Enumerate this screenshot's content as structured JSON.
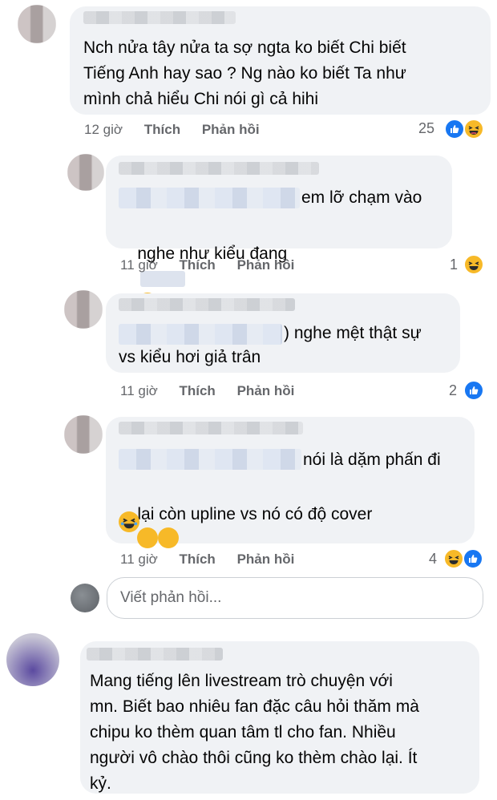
{
  "comments": [
    {
      "text": "Nch nửa tây nửa ta sợ ngta ko biết Chi biết\nTiếng Anh hay sao ? Ng nào ko biết Ta như\nmình chả hiểu Chi nói gì cả hihi",
      "time": "12 giờ",
      "like": "Thích",
      "reply": "Phản hồi",
      "reactions": "25",
      "reaction_icons": [
        "like-icon",
        "haha-icon"
      ]
    }
  ],
  "replies": [
    {
      "line1": "em lỡ chạm vào",
      "line2a": "nghe như kiểu đang",
      "time": "11 giờ",
      "like": "Thích",
      "reply": "Phản hồi",
      "reactions": "1",
      "reaction_icons": [
        "haha-icon"
      ]
    },
    {
      "line1": ") nghe mệt thật sự",
      "line2": "vs kiểu hơi giả trân",
      "time": "11 giờ",
      "like": "Thích",
      "reply": "Phản hồi",
      "reactions": "2",
      "reaction_icons": [
        "like-icon"
      ]
    },
    {
      "line1": "nói là dặm phấn đi",
      "line2": "lại còn upline vs nó có độ cover",
      "time": "11 giờ",
      "like": "Thích",
      "reply": "Phản hồi",
      "reactions": "4",
      "reaction_icons": [
        "haha-icon",
        "like-icon"
      ]
    }
  ],
  "reply_input": {
    "placeholder": "Viết phản hồi..."
  },
  "last_comment": {
    "text": "Mang tiếng lên livestream trò chuyện với\nmn. Biết bao nhiêu fan đặc câu hỏi thăm mà\nchipu ko thèm quan tâm tl cho fan. Nhiều\nngười vô chào thôi cũng ko thèm chào lại. Ít\nkỷ."
  },
  "colors": {
    "like_blue": "#1877f2",
    "haha_yellow": "#f7b928",
    "bubble": "#f0f2f5",
    "meta_gray": "#65676b"
  }
}
